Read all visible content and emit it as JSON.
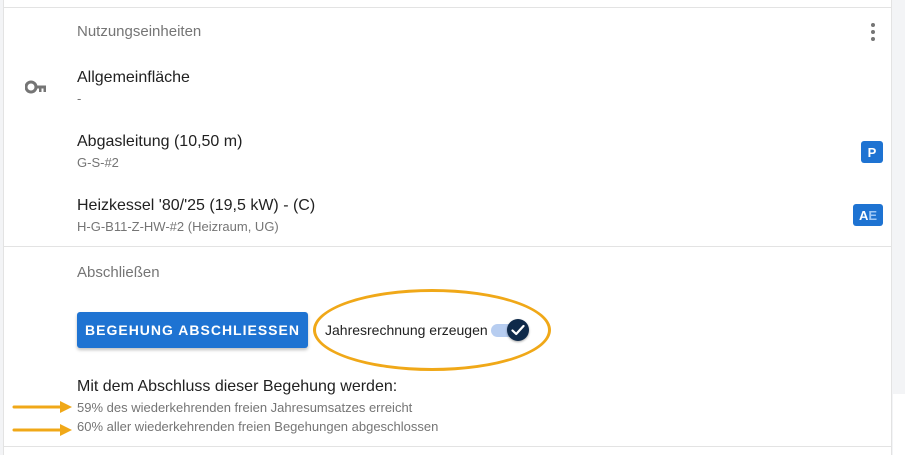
{
  "units_section": {
    "label": "Nutzungseinheiten",
    "menu_icon": "more-vert-icon",
    "items": [
      {
        "icon": "key-icon",
        "title": "Allgemeinfläche",
        "subtitle": "-"
      },
      {
        "title": "Abgasleitung (10,50 m)",
        "subtitle": "G-S-#2",
        "badge": "P"
      },
      {
        "title": "Heizkessel '80/'25 (19,5 kW) - (C)",
        "subtitle": "H-G-B11-Z-HW-#2 (Heizraum, UG)",
        "badge_a": "A",
        "badge_e": "E"
      }
    ]
  },
  "close_section": {
    "label": "Abschließen",
    "button_label": "BEGEHUNG ABSCHLIESSEN",
    "toggle": {
      "label": "Jahresrechnung erzeugen",
      "checked": true
    }
  },
  "summary": {
    "heading": "Mit dem Abschluss dieser Begehung werden:",
    "lines": [
      "59% des wiederkehrenden freien Jahresumsatzes erreicht",
      "60% aller wiederkehrenden freien Begehungen abgeschlossen"
    ]
  },
  "colors": {
    "primary": "#1e73d2",
    "annotation": "#f0a818",
    "toggle_knob": "#0f2a4a"
  }
}
